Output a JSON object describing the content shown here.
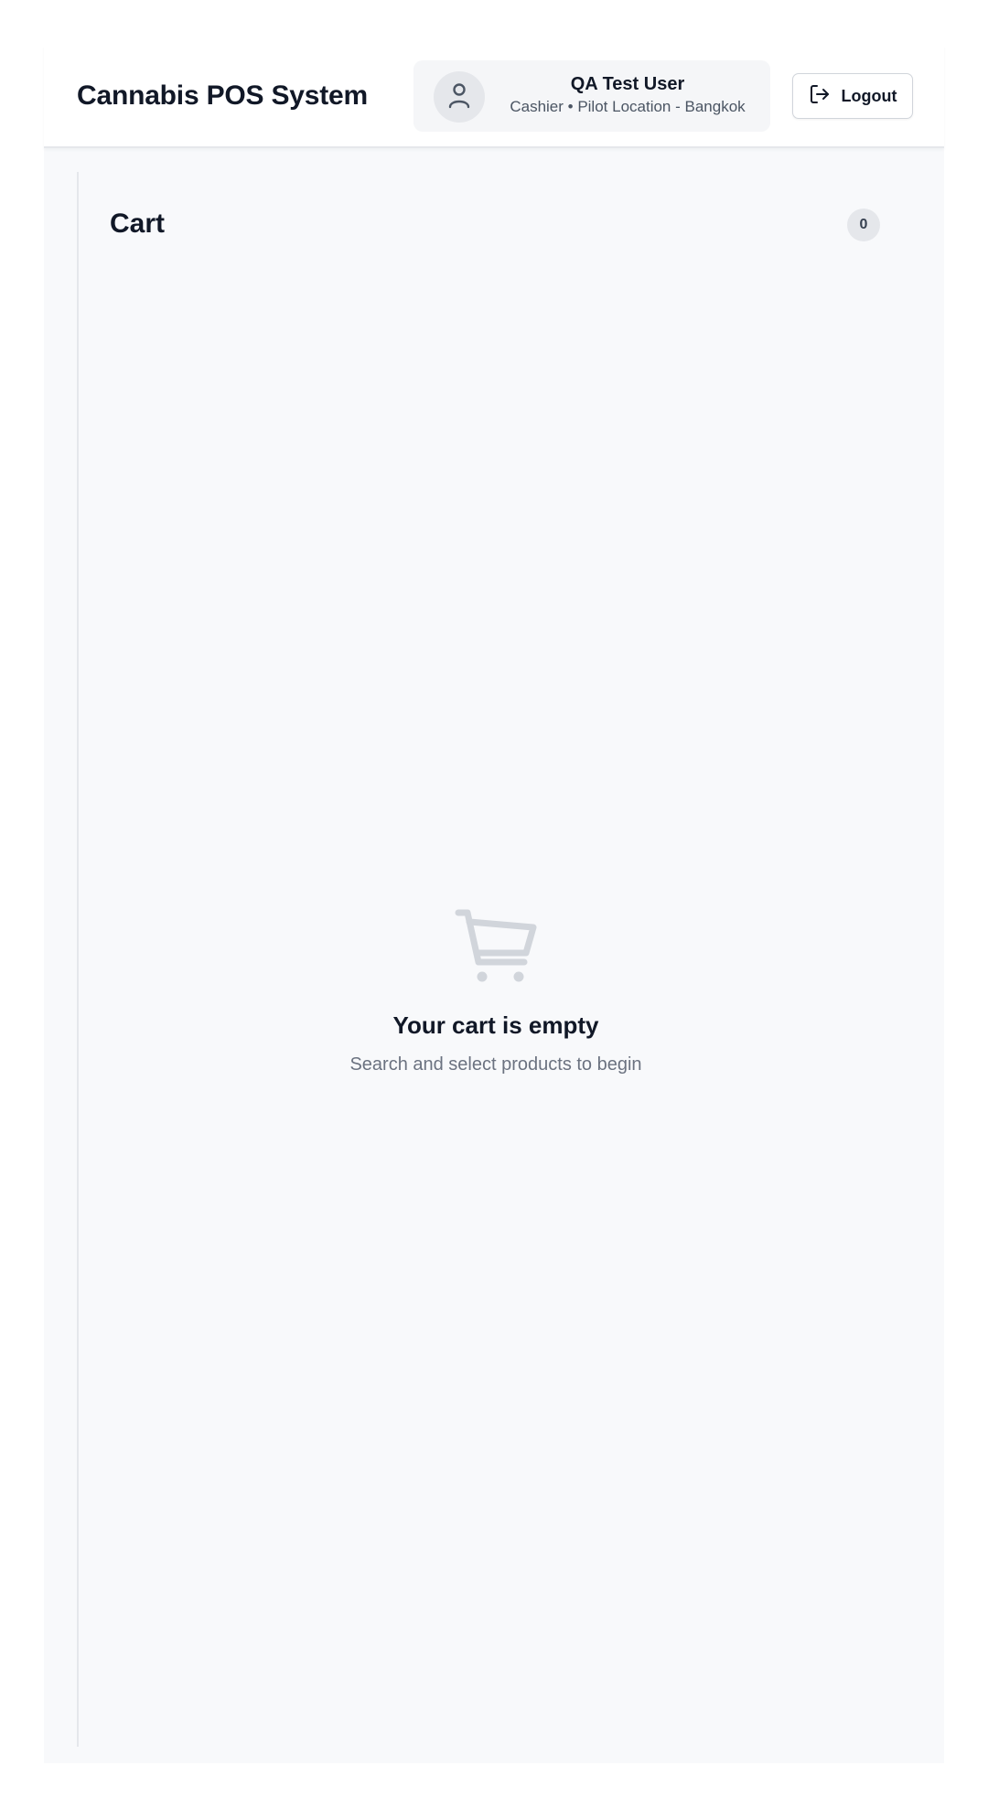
{
  "header": {
    "title": "Cannabis POS System",
    "user": {
      "name": "QA Test User",
      "role": "Cashier • Pilot Location - Bangkok",
      "avatar_icon": "user-icon"
    },
    "logout": {
      "label": "Logout",
      "icon": "logout-icon"
    }
  },
  "cart": {
    "title": "Cart",
    "count": "0",
    "empty_state": {
      "icon": "shopping-cart-icon",
      "title": "Your cart is empty",
      "subtitle": "Search and select products to begin"
    }
  },
  "colors": {
    "background": "#f8f9fb",
    "header_background": "#ffffff",
    "text_primary": "#111827",
    "text_secondary": "#6b7280",
    "empty_icon": "#d1d5db",
    "badge_background": "#e5e7eb"
  }
}
